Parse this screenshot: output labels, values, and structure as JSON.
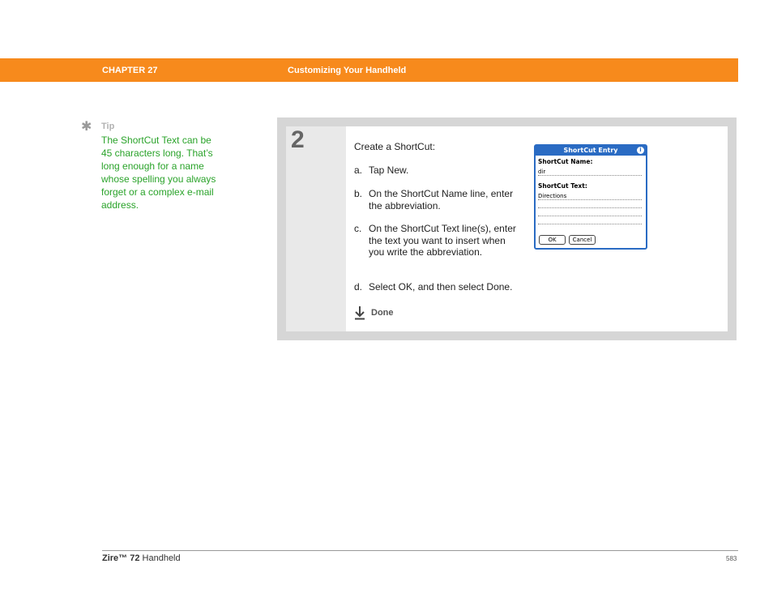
{
  "header": {
    "chapter": "CHAPTER 27",
    "title": "Customizing Your Handheld",
    "bar_color": "#f78a1c"
  },
  "tip": {
    "icon": "asterisk-icon",
    "label": "Tip",
    "text": "The ShortCut Text can be 45 characters long. That’s long enough for a name whose spelling you always forget or a complex e-mail address."
  },
  "step": {
    "number": "2",
    "intro": "Create a ShortCut:",
    "items": [
      {
        "mark": "a.",
        "text": "Tap New."
      },
      {
        "mark": "b.",
        "text": "On the ShortCut Name line, enter the abbreviation."
      },
      {
        "mark": "c.",
        "text": "On the ShortCut Text line(s), enter the text you want to insert when you write the abbreviation."
      },
      {
        "mark": "d.",
        "text": "Select OK, and then select Done."
      }
    ],
    "done_icon": "down-arrow-icon",
    "done_label": "Done"
  },
  "dialog": {
    "title": "ShortCut Entry",
    "info_icon": "info-icon",
    "name_label": "ShortCut Name:",
    "name_value": "dir",
    "text_label": "ShortCut Text:",
    "text_value": "Directions",
    "ok_label": "OK",
    "cancel_label": "Cancel",
    "accent": "#2a6bc3"
  },
  "footer": {
    "product_bold": "Zire™ 72",
    "product_rest": " Handheld",
    "page": "583"
  }
}
